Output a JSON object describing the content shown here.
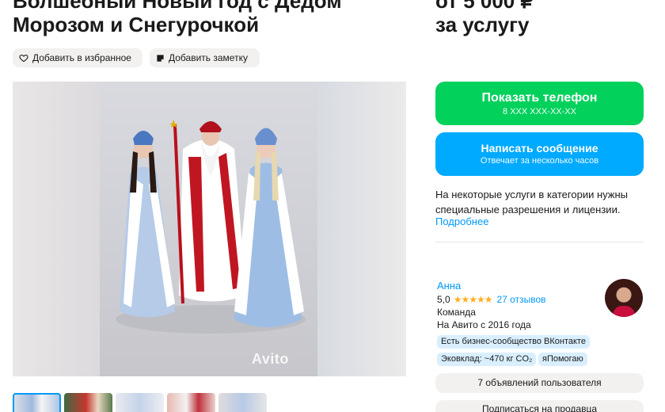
{
  "listing": {
    "title_line1": "Волшебный Новый год с Дедом",
    "title_line2": "Морозом и Снегурочкой",
    "price_line1": "от 5 000 ₽",
    "price_line2": "за услугу"
  },
  "actions": {
    "favorite": "Добавить в избранное",
    "note": "Добавить заметку"
  },
  "gallery": {
    "watermark": "Avito",
    "thumbnail_count": 5
  },
  "contact": {
    "phone_label": "Показать телефон",
    "phone_masked": "8 XXX XXX-XX-XX",
    "message_label": "Написать сообщение",
    "message_sub": "Отвечает за несколько часов"
  },
  "notice": {
    "text": "На некоторые услуги в категории нужны специальные разрешения и лицензии.",
    "link": "Подробнее"
  },
  "seller": {
    "name": "Анна",
    "rating": "5,0",
    "stars": "★★★★★",
    "reviews": "27 отзывов",
    "type": "Команда",
    "since": "На Авито с 2016 года",
    "tags": [
      "Есть бизнес-сообщество ВКонтакте",
      "Эковклад: ~470 кг CO₂",
      "яПомогаю"
    ],
    "ads_button": "7 объявлений пользователя",
    "subscribe_button": "Подписаться на продавца"
  },
  "colors": {
    "green": "#02d15c",
    "blue": "#00aaff",
    "link": "#0099f7",
    "star": "#ffb021"
  },
  "icons": [
    "heart-icon",
    "note-icon",
    "star-icon"
  ]
}
